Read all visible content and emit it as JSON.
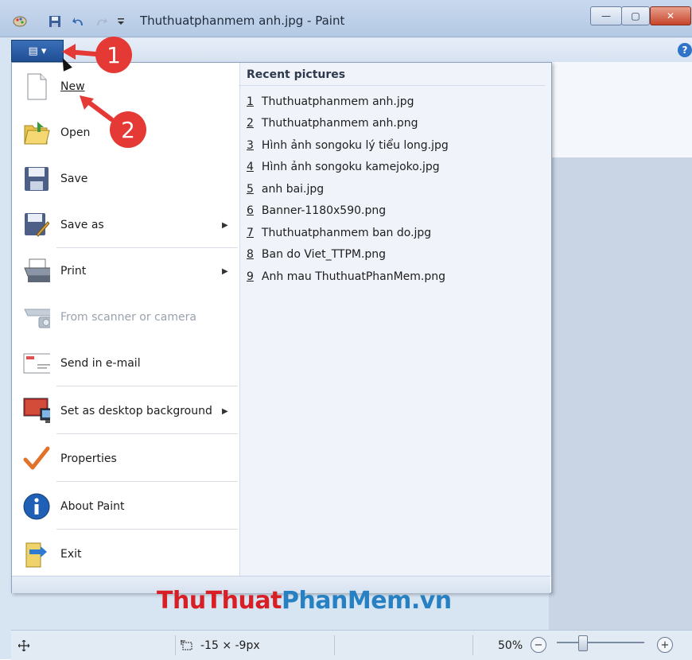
{
  "window": {
    "title": "Thuthuatphanmem anh.jpg - Paint",
    "buttons": {
      "minimize": "—",
      "maximize": "▢",
      "close": "✕"
    }
  },
  "quick_access": {
    "app_icon": "paint-palette-icon",
    "save_icon": "save-icon",
    "undo_icon": "undo-icon",
    "redo_icon": "redo-icon",
    "customize_icon": "dropdown-arrow-icon"
  },
  "file_button": {
    "label": "▤ ▾"
  },
  "help": {
    "label": "?"
  },
  "menu": {
    "items": [
      {
        "label": "New",
        "icon": "blank-page-icon",
        "has_submenu": false,
        "enabled": true
      },
      {
        "label": "Open",
        "icon": "open-folder-icon",
        "has_submenu": false,
        "enabled": true
      },
      {
        "label": "Save",
        "icon": "floppy-disk-icon",
        "has_submenu": false,
        "enabled": true
      },
      {
        "label": "Save as",
        "icon": "save-as-icon",
        "has_submenu": true,
        "enabled": true
      },
      {
        "label": "Print",
        "icon": "printer-icon",
        "has_submenu": true,
        "enabled": true
      },
      {
        "label": "From scanner or camera",
        "icon": "scanner-camera-icon",
        "has_submenu": false,
        "enabled": false
      },
      {
        "label": "Send in e-mail",
        "icon": "email-envelope-icon",
        "has_submenu": false,
        "enabled": true
      },
      {
        "label": "Set as desktop background",
        "icon": "desktop-monitor-icon",
        "has_submenu": true,
        "enabled": true
      },
      {
        "label": "Properties",
        "icon": "check-mark-icon",
        "has_submenu": false,
        "enabled": true
      },
      {
        "label": "About Paint",
        "icon": "info-icon",
        "has_submenu": false,
        "enabled": true
      },
      {
        "label": "Exit",
        "icon": "exit-door-icon",
        "has_submenu": false,
        "enabled": true
      }
    ],
    "submenu_arrow": "▶"
  },
  "recent": {
    "title": "Recent pictures",
    "items": [
      {
        "num": "1",
        "name": "Thuthuatphanmem anh.jpg"
      },
      {
        "num": "2",
        "name": "Thuthuatphanmem anh.png"
      },
      {
        "num": "3",
        "name": "Hình ảnh songoku lý tiểu long.jpg"
      },
      {
        "num": "4",
        "name": "Hình ảnh songoku kamejoko.jpg"
      },
      {
        "num": "5",
        "name": "anh bai.jpg"
      },
      {
        "num": "6",
        "name": "Banner-1180x590.png"
      },
      {
        "num": "7",
        "name": "Thuthuatphanmem ban do.jpg"
      },
      {
        "num": "8",
        "name": "Ban do Viet_TTPM.png"
      },
      {
        "num": "9",
        "name": "Anh mau ThuthuatPhanMem.png"
      }
    ]
  },
  "annotations": {
    "badge1": "1",
    "badge2": "2"
  },
  "watermark": {
    "part1": "ThuThuat",
    "part2": "PhanMem",
    "part3": ".vn"
  },
  "statusbar": {
    "cursor_icon": "move-crosshair-icon",
    "selection_icon": "selection-size-icon",
    "selection_size": "-15 × -9px",
    "zoom": "50%",
    "zoom_out": "−",
    "zoom_in": "+",
    "zoom_level": 0.3
  },
  "colors": {
    "accent": "#1f4f95",
    "badge": "#e53935",
    "watermark_red": "#d81f26",
    "watermark_blue": "#2680c2"
  }
}
